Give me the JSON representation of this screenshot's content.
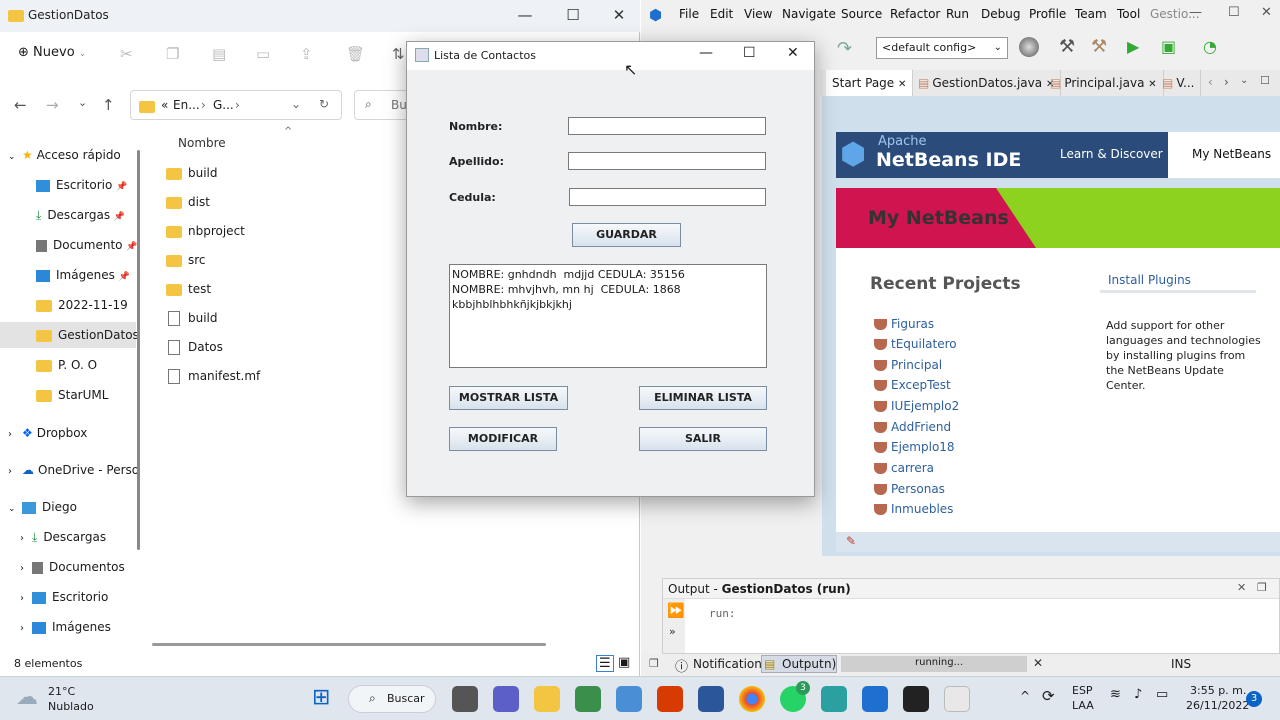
{
  "explorer": {
    "title": "GestionDatos",
    "new_label": "Nuevo",
    "breadcrumb": {
      "prefix": "«",
      "part1": "En...",
      "part2": "G..."
    },
    "search_placeholder": "Bu",
    "column_name": "Nombre",
    "status": "8 elementos",
    "nav": [
      {
        "label": "Acceso rápido",
        "icon": "star-icon"
      },
      {
        "label": "Escritorio",
        "icon": "desktop-icon"
      },
      {
        "label": "Descargas",
        "icon": "download-icon"
      },
      {
        "label": "Documento",
        "icon": "document-icon"
      },
      {
        "label": "Imágenes",
        "icon": "image-icon"
      },
      {
        "label": "2022-11-19",
        "icon": "folder-icon"
      },
      {
        "label": "GestionDatos",
        "icon": "folder-icon"
      },
      {
        "label": "P. O. O",
        "icon": "folder-icon"
      },
      {
        "label": "StarUML",
        "icon": "folder-icon"
      },
      {
        "label": "Dropbox",
        "icon": "dropbox-icon"
      },
      {
        "label": "OneDrive - Perso",
        "icon": "onedrive-icon"
      },
      {
        "label": "Diego",
        "icon": "pc-icon"
      },
      {
        "label": "Descargas",
        "icon": "download-icon"
      },
      {
        "label": "Documentos",
        "icon": "document-icon"
      },
      {
        "label": "Escritorio",
        "icon": "desktop-icon"
      },
      {
        "label": "Imágenes",
        "icon": "image-icon"
      }
    ],
    "files": [
      {
        "name": "build",
        "type": "folder"
      },
      {
        "name": "dist",
        "type": "folder"
      },
      {
        "name": "nbproject",
        "type": "folder"
      },
      {
        "name": "src",
        "type": "folder"
      },
      {
        "name": "test",
        "type": "folder"
      },
      {
        "name": "build",
        "type": "file"
      },
      {
        "name": "Datos",
        "type": "file"
      },
      {
        "name": "manifest.mf",
        "type": "file"
      }
    ]
  },
  "netbeans": {
    "title_suffix": "Gestio...",
    "menu": [
      "File",
      "Edit",
      "View",
      "Navigate",
      "Source",
      "Refactor",
      "Run",
      "Debug",
      "Profile",
      "Team",
      "Tool"
    ],
    "config": "<default config>",
    "tabs": [
      "Start Page",
      "GestionDatos.java",
      "Principal.java",
      "V..."
    ],
    "brand_top": "Apache",
    "brand": "NetBeans IDE",
    "nav_learn": "Learn & Discover",
    "nav_my": "My NetBeans",
    "banner": "My NetBeans",
    "recent_title": "Recent Projects",
    "install_plugins": "Install Plugins",
    "plugins_text": "Add support for other languages and technologies by installing plugins from the NetBeans Update Center.",
    "projects": [
      "Figuras",
      "tEquilatero",
      "Principal",
      "ExcepTest",
      "IUEjemplo2",
      "AddFriend",
      "Ejemplo18",
      "carrera",
      "Personas",
      "Inmuebles"
    ],
    "output_label": "Output - ",
    "output_title": "GestionDatos (run)",
    "output_line": "run:",
    "status_notifications": "Notifications",
    "status_output": "Output",
    "status_output_tail": "n)",
    "status_running": "running...",
    "status_ins": "INS"
  },
  "dialog": {
    "title": "Lista de Contactos",
    "nombre_label": "Nombre:",
    "apellido_label": "Apellido:",
    "cedula_label": "Cedula:",
    "nombre_value": "",
    "apellido_value": "",
    "cedula_value": "",
    "guardar": "GUARDAR",
    "textarea": "NOMBRE: gnhdndh  mdjjd CEDULA: 35156\nNOMBRE: mhvjhvh, mn hj  CEDULA: 1868\nkbbjhblhbhkñjkjbkjkhj",
    "mostrar": "MOSTRAR LISTA",
    "eliminar": "ELIMINAR LISTA",
    "modificar": "MODIFICAR",
    "salir": "SALIR"
  },
  "taskbar": {
    "temp": "21°C",
    "weather": "Nublado",
    "search": "Buscar",
    "lang1": "ESP",
    "lang2": "LAA",
    "time": "3:55 p. m.",
    "date": "26/11/2022",
    "badge": "3",
    "whatsapp_badge": "3"
  }
}
